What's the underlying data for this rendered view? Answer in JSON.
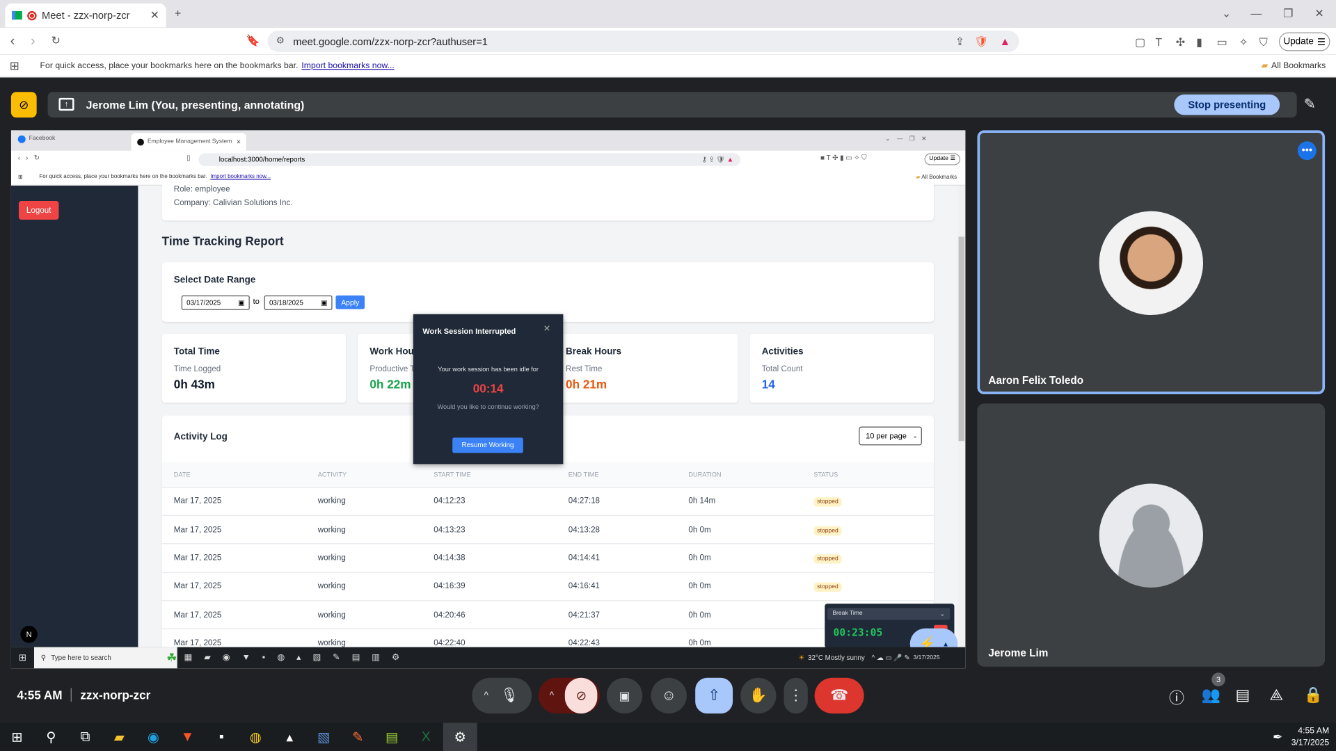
{
  "browser": {
    "tab_title": "Meet - zzx-norp-zcr",
    "url": "meet.google.com/zzx-norp-zcr?authuser=1",
    "bookmarks_hint": "For quick access, place your bookmarks here on the bookmarks bar.",
    "import_link": "Import bookmarks now...",
    "all_bookmarks": "All Bookmarks",
    "update_label": "Update"
  },
  "meet": {
    "presenting_label": "Jerome Lim (You, presenting, annotating)",
    "stop_presenting": "Stop presenting",
    "time": "4:55 AM",
    "meeting_code": "zzx-norp-zcr",
    "participants_count": "3",
    "participants": [
      {
        "name": "Aaron Felix Toledo"
      },
      {
        "name": "Jerome Lim"
      }
    ]
  },
  "shared": {
    "tabs": [
      "Facebook",
      "Employee Management System"
    ],
    "url": "localhost:3000/home/reports",
    "bookmarks_hint": "For quick access, place your bookmarks here on the bookmarks bar.",
    "import_link": "Import bookmarks now...",
    "all_bookmarks": "All Bookmarks",
    "update_label": "Update",
    "logout": "Logout",
    "role": "Role: employee",
    "company": "Company: Calivian Solutions Inc.",
    "report_title": "Time Tracking Report",
    "date_range": {
      "title": "Select Date Range",
      "from": "03/17/2025",
      "to_label": "to",
      "to": "03/18/2025",
      "apply": "Apply"
    },
    "stats": [
      {
        "title": "Total Time",
        "label": "Time Logged",
        "value": "0h 43m",
        "color": "#111827"
      },
      {
        "title": "Work Hours",
        "label": "Productive Time",
        "value": "0h 22m",
        "color": "#16a34a"
      },
      {
        "title": "Break Hours",
        "label": "Rest Time",
        "value": "0h 21m",
        "color": "#ea580c"
      },
      {
        "title": "Activities",
        "label": "Total Count",
        "value": "14",
        "color": "#2563eb"
      }
    ],
    "activity_log": {
      "title": "Activity Log",
      "per_page": "10 per page",
      "columns": [
        "DATE",
        "ACTIVITY",
        "START TIME",
        "END TIME",
        "DURATION",
        "STATUS"
      ],
      "rows": [
        [
          "Mar 17, 2025",
          "working",
          "04:12:23",
          "04:27:18",
          "0h 14m",
          "stopped"
        ],
        [
          "Mar 17, 2025",
          "working",
          "04:13:23",
          "04:13:28",
          "0h 0m",
          "stopped"
        ],
        [
          "Mar 17, 2025",
          "working",
          "04:14:38",
          "04:14:41",
          "0h 0m",
          "stopped"
        ],
        [
          "Mar 17, 2025",
          "working",
          "04:16:39",
          "04:16:41",
          "0h 0m",
          "stopped"
        ],
        [
          "Mar 17, 2025",
          "working",
          "04:20:46",
          "04:21:37",
          "0h 0m",
          ""
        ],
        [
          "Mar 17, 2025",
          "working",
          "04:22:40",
          "04:22:43",
          "0h 0m",
          ""
        ]
      ]
    },
    "modal": {
      "title": "Work Session Interrupted",
      "message": "Your work session has been idle for",
      "timer": "00:14",
      "question": "Would you like to continue working?",
      "button": "Resume Working"
    },
    "widget": {
      "mode": "Break Time",
      "timer": "00:23:05"
    },
    "taskbar": {
      "search": "Type here to search",
      "weather": "32°C  Mostly sunny",
      "date": "3/17/2025"
    }
  },
  "windows": {
    "time": "4:55 AM",
    "date": "3/17/2025"
  }
}
